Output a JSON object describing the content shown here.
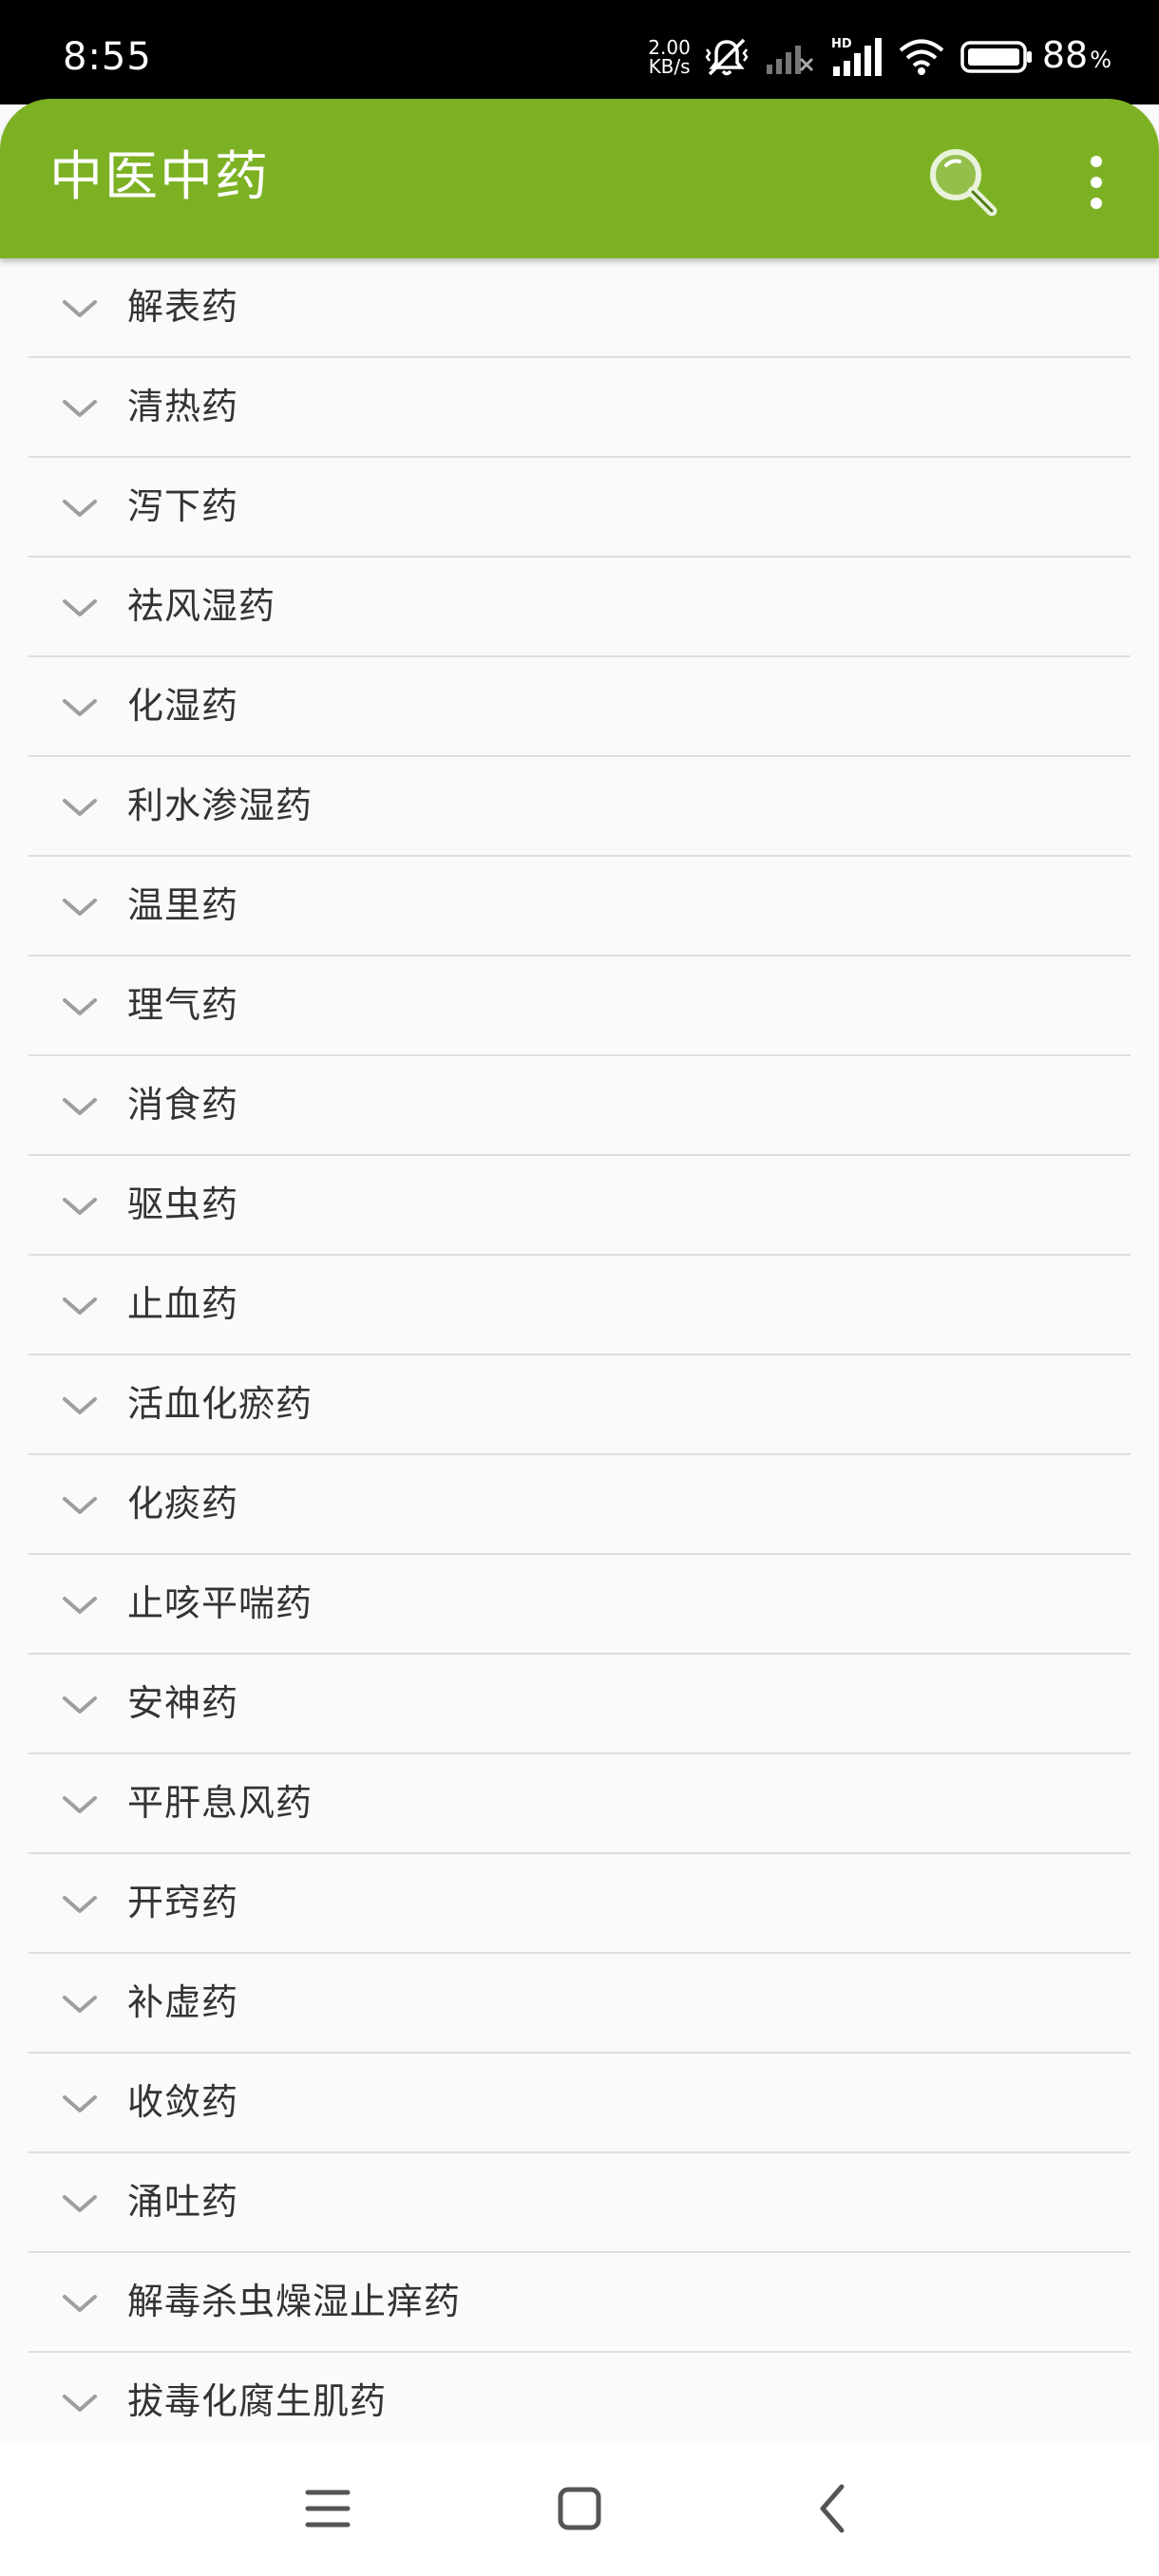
{
  "status_bar": {
    "time": "8:55",
    "net_speed_value": "2.00",
    "net_speed_unit": "KB/s",
    "hd_badge": "HD",
    "battery_percent": "88",
    "battery_percent_sign": "%",
    "icons": [
      "vibrate-silent-icon",
      "signal-off-icon",
      "signal-icon",
      "wifi-icon",
      "battery-icon"
    ]
  },
  "app_bar": {
    "title": "中医中药",
    "color": "#7db124",
    "actions": [
      "search-icon",
      "more-vert-icon"
    ]
  },
  "categories": [
    {
      "label": "解表药"
    },
    {
      "label": "清热药"
    },
    {
      "label": "泻下药"
    },
    {
      "label": "祛风湿药"
    },
    {
      "label": "化湿药"
    },
    {
      "label": "利水渗湿药"
    },
    {
      "label": "温里药"
    },
    {
      "label": "理气药"
    },
    {
      "label": "消食药"
    },
    {
      "label": "驱虫药"
    },
    {
      "label": "止血药"
    },
    {
      "label": "活血化瘀药"
    },
    {
      "label": "化痰药"
    },
    {
      "label": "止咳平喘药"
    },
    {
      "label": "安神药"
    },
    {
      "label": "平肝息风药"
    },
    {
      "label": "开窍药"
    },
    {
      "label": "补虚药"
    },
    {
      "label": "收敛药"
    },
    {
      "label": "涌吐药"
    },
    {
      "label": "解毒杀虫燥湿止痒药"
    },
    {
      "label": "拔毒化腐生肌药"
    }
  ],
  "category_row_icon": "chevron-down-icon",
  "nav_bar": {
    "buttons": [
      "menu-icon",
      "home-icon",
      "back-icon"
    ]
  }
}
